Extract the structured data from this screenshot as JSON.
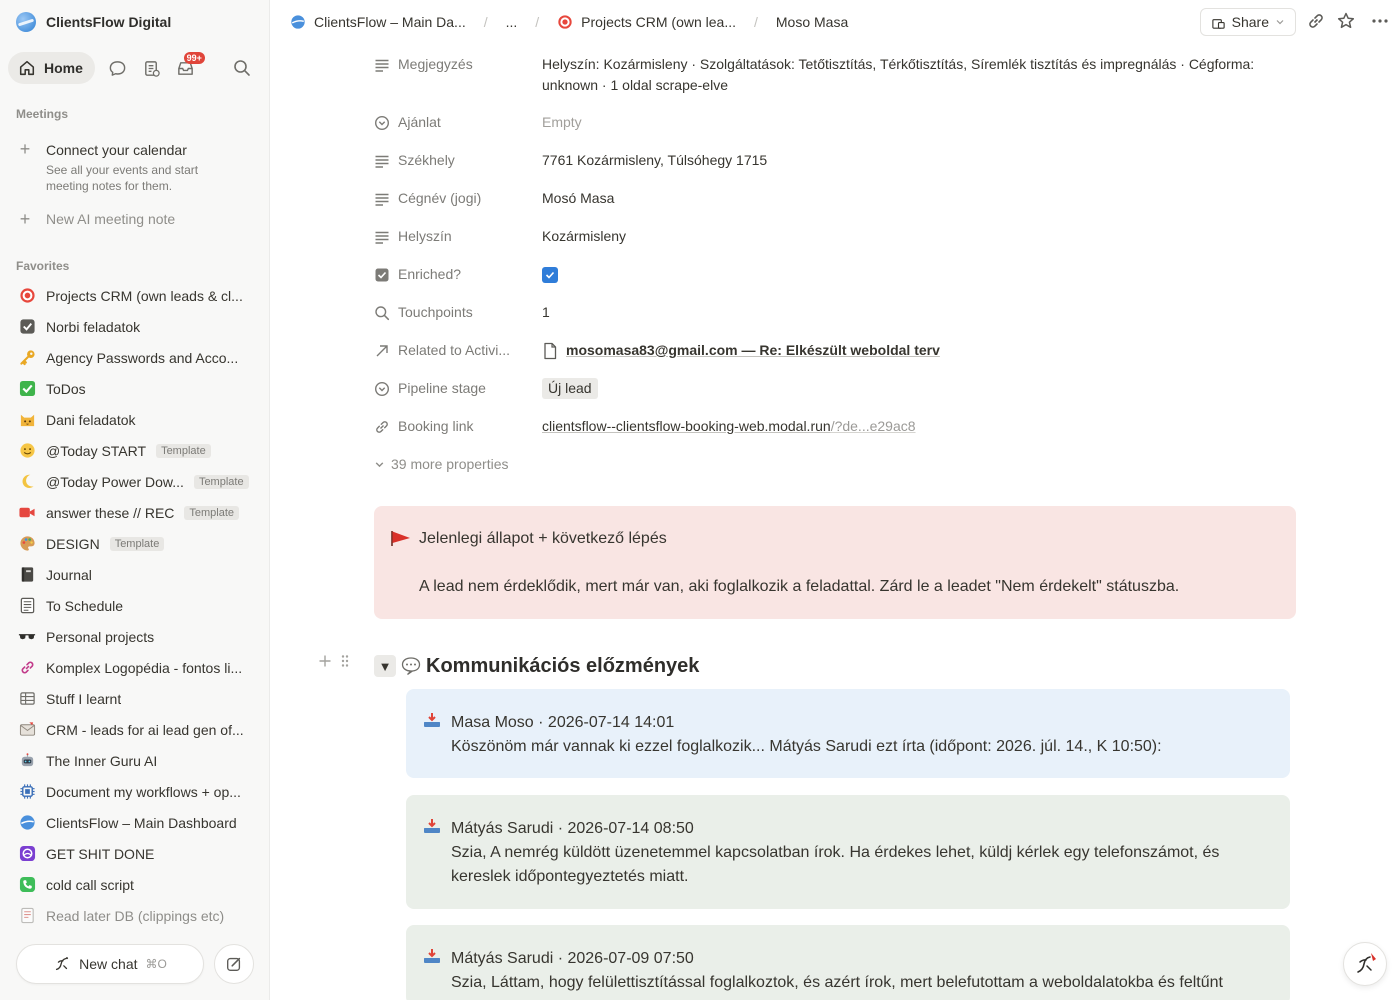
{
  "workspace": {
    "name": "ClientsFlow Digital"
  },
  "topnav": {
    "home_label": "Home",
    "inbox_badge": "99+"
  },
  "meetings": {
    "section_label": "Meetings",
    "connect_title": "Connect your calendar",
    "connect_sub_1": "See all your events and start",
    "connect_sub_2": "meeting notes for them.",
    "new_note": "New AI meeting note"
  },
  "favorites": {
    "section_label": "Favorites",
    "items": [
      {
        "label": "Projects CRM (own leads & cl...",
        "icon": "target-icon"
      },
      {
        "label": "Norbi feladatok",
        "icon": "checkbox-icon"
      },
      {
        "label": "Agency Passwords and Acco...",
        "icon": "key-icon"
      },
      {
        "label": "ToDos",
        "icon": "check-mark-icon"
      },
      {
        "label": "Dani feladatok",
        "icon": "cat-face-icon"
      },
      {
        "label": "@Today START",
        "icon": "smile-face-icon",
        "tag": "Template"
      },
      {
        "label": "@Today Power Dow...",
        "icon": "moon-icon",
        "tag": "Template"
      },
      {
        "label": "answer these // REC",
        "icon": "video-camera-icon",
        "tag": "Template"
      },
      {
        "label": "DESIGN",
        "icon": "palette-icon",
        "tag": "Template"
      },
      {
        "label": "Journal",
        "icon": "notebook-icon"
      },
      {
        "label": "To Schedule",
        "icon": "ledger-icon"
      },
      {
        "label": "Personal projects",
        "icon": "sunglasses-icon"
      },
      {
        "label": "Komplex Logopédia - fontos li...",
        "icon": "link-icon"
      },
      {
        "label": "Stuff I learnt",
        "icon": "table-icon"
      },
      {
        "label": "CRM - leads for ai lead gen of...",
        "icon": "envelope-icon"
      },
      {
        "label": "The Inner Guru AI",
        "icon": "robot-icon"
      },
      {
        "label": "Document my workflows + op...",
        "icon": "chip-icon"
      },
      {
        "label": "ClientsFlow – Main Dashboard",
        "icon": "globe-icon"
      },
      {
        "label": "GET SHIT DONE",
        "icon": "purple-logo-icon"
      },
      {
        "label": "cold call script",
        "icon": "phone-icon"
      },
      {
        "label": "Read later DB (clippings etc)",
        "icon": "document-icon"
      }
    ]
  },
  "bottom": {
    "new_chat": "New chat",
    "shortcut": "⌘O"
  },
  "breadcrumbs": {
    "c1": "ClientsFlow – Main Da...",
    "c2": "...",
    "c3": "Projects CRM (own lea...",
    "c4": "Moso Masa"
  },
  "topbar": {
    "share": "Share"
  },
  "properties": {
    "megjegyzes_key": "Megjegyzés",
    "megjegyzes_val": "Helyszín: Kozármisleny · Szolgáltatások: Tetőtisztítás, Térkőtisztítás, Síremlék tisztítás és impregnálás · Cégforma: unknown · 1 oldal scrape-elve",
    "ajanlat_key": "Ajánlat",
    "ajanlat_val": "Empty",
    "szekhely_key": "Székhely",
    "szekhely_val": "7761 Kozármisleny, Túlsóhegy 1715",
    "cegnev_key": "Cégnév (jogi)",
    "cegnev_val": "Mosó Masa",
    "helyszin_key": "Helyszín",
    "helyszin_val": "Kozármisleny",
    "enriched_key": "Enriched?",
    "touchpoints_key": "Touchpoints",
    "touchpoints_val": "1",
    "related_key": "Related to Activi...",
    "related_val": "mosomasa83@gmail.com — Re: Elkészült weboldal terv",
    "pipeline_key": "Pipeline stage",
    "pipeline_val": "Új lead",
    "booking_key": "Booking link",
    "booking_main": "clientsflow--clientsflow-booking-web.modal.run",
    "booking_rest": "/?de...e29ac8",
    "more": "39 more properties"
  },
  "callout": {
    "title": "Jelenlegi állapot + következő lépés",
    "text": "A lead nem érdeklődik, mert már van, aki foglalkozik a feladattal. Zárd le a leadet \"Nem érdekelt\" státuszba."
  },
  "history": {
    "title": "Kommunikációs előzmények",
    "messages": [
      {
        "head": "Masa Moso · 2026-07-14 14:01",
        "body": "Köszönöm már vannak ki ezzel foglalkozik... Mátyás Sarudi ezt írta (időpont: 2026. júl. 14., K 10:50):"
      },
      {
        "head": "Mátyás Sarudi · 2026-07-14 08:50",
        "body_1": "Szia, A nemrég küldött üzenetemmel kapcsolatban írok. Ha érdekes lehet, küldj kérlek egy telefonszámot, és",
        "body_2": "kereslek időpontegyeztetés miatt."
      },
      {
        "head": "Mátyás Sarudi · 2026-07-09 07:50",
        "body": "Szia, Láttam, hogy felülettisztítással foglalkoztok, és azért írok, mert belefutottam a weboldalatokba és feltűnt"
      }
    ]
  },
  "colors": {
    "accent": "#2f7dd9",
    "callout_bg": "#f9e5e3",
    "msg_blue": "#e8f1fa",
    "msg_green": "#eaefe9",
    "badge": "#e0453a"
  }
}
